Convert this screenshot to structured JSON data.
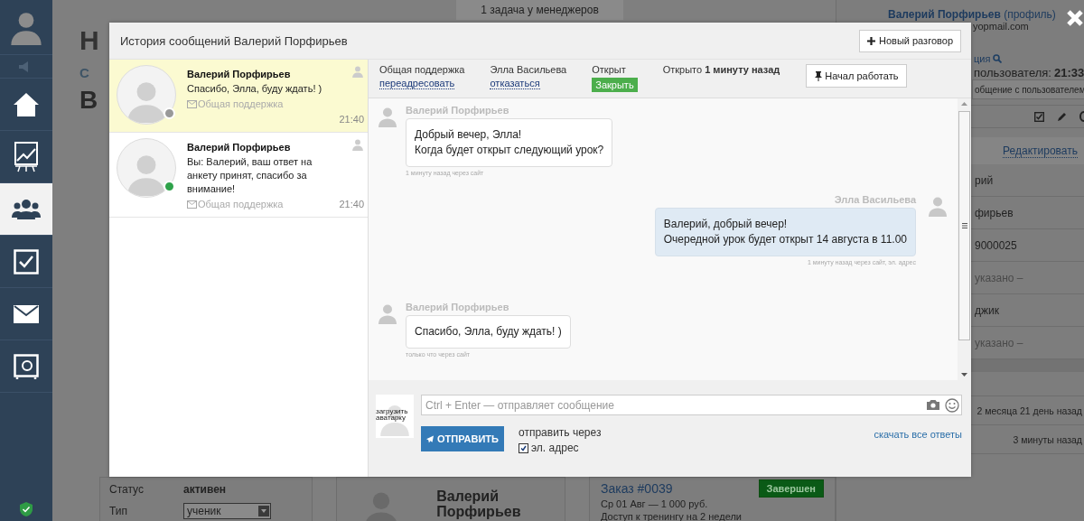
{
  "background": {
    "top_banner": "1 задача у менеджеров",
    "nav_items": [
      {
        "selected": false
      },
      {
        "selected": false
      },
      {
        "selected": true
      },
      {
        "selected": false
      },
      {
        "selected": false
      },
      {
        "selected": false
      }
    ],
    "heading_fragments": [
      "Н",
      "С",
      "В"
    ],
    "profile": {
      "name": "Валерий Порфирьев",
      "profile_link": "(профиль)",
      "email": "yopmail.com",
      "session": "ция",
      "local_time_label": "пользователя:",
      "local_time": "21:33",
      "message_button": "общение с пользователем",
      "edit_link": "Редактировать",
      "fields": [
        {
          "value": "рий",
          "muted": false
        },
        {
          "value": "фирьев",
          "muted": false
        },
        {
          "value": "9000025",
          "muted": false
        },
        {
          "value": "указано –",
          "muted": true
        },
        {
          "value": "джик",
          "muted": false
        },
        {
          "value": "указано –",
          "muted": true
        }
      ],
      "times": [
        "2 месяца 21 день назад",
        "3 минуты назад"
      ]
    },
    "bottom": {
      "status_label": "Статус",
      "status": "активен",
      "type_label": "Тип",
      "type": "ученик",
      "person_name": "Валерий Порфирьев",
      "order": "Заказ #0039",
      "order_badge": "Завершен",
      "order_line": "Ср 01 Авг — 1 000 руб.",
      "order_desc": "Доступ к тренингу на 2 недели"
    }
  },
  "modal": {
    "title": "История сообщений Валерий Порфирьев",
    "new_button": "Новый разговор",
    "conversations": [
      {
        "name": "Валерий Порфирьев",
        "preview": "Спасибо, Элла, буду ждать! )",
        "channel": "Общая поддержка",
        "time": "21:40",
        "selected": true,
        "online": false
      },
      {
        "name": "Валерий Порфирьев",
        "preview": "Вы: Валерий, ваш ответ на анкету принят, спасибо за внимание!",
        "channel": "Общая поддержка",
        "time": "21:40",
        "selected": false,
        "online": true
      }
    ],
    "info": {
      "channel": "Общая поддержка",
      "channel_action": "переадресовать",
      "manager": "Элла Васильева",
      "manager_action": "отказаться",
      "status": "Открыт",
      "close_button": "Закрыть",
      "opened": "Открыто **1 минуту назад**",
      "work_button": "Начал работать"
    },
    "messages": [
      {
        "author": "Валерий Порфирьев",
        "lines": [
          "Добрый вечер, Элла!",
          "Когда будет открыт следующий урок?"
        ],
        "meta": "1 минуту назад через сайт",
        "outgoing": false
      },
      {
        "author": "Элла Васильева",
        "lines": [
          "Валерий, добрый вечер!",
          "Очередной урок будет открыт 14 августа в 11.00"
        ],
        "meta": "1 минуту назад через сайт, эл. адрес",
        "outgoing": true
      },
      {
        "author": "Валерий Порфирьев",
        "lines": [
          "Спасибо, Элла, буду ждать! )"
        ],
        "meta": "только что через сайт",
        "outgoing": false
      }
    ],
    "composer": {
      "avatar_caption": "загрузить аватарку",
      "placeholder": "Ctrl + Enter — отправляет сообщение",
      "send_button": "ОТПРАВИТЬ",
      "send_via": "отправить через",
      "channels": [
        {
          "label": "эл. адрес",
          "checked": true
        }
      ],
      "download_link": "скачать все ответы"
    }
  }
}
